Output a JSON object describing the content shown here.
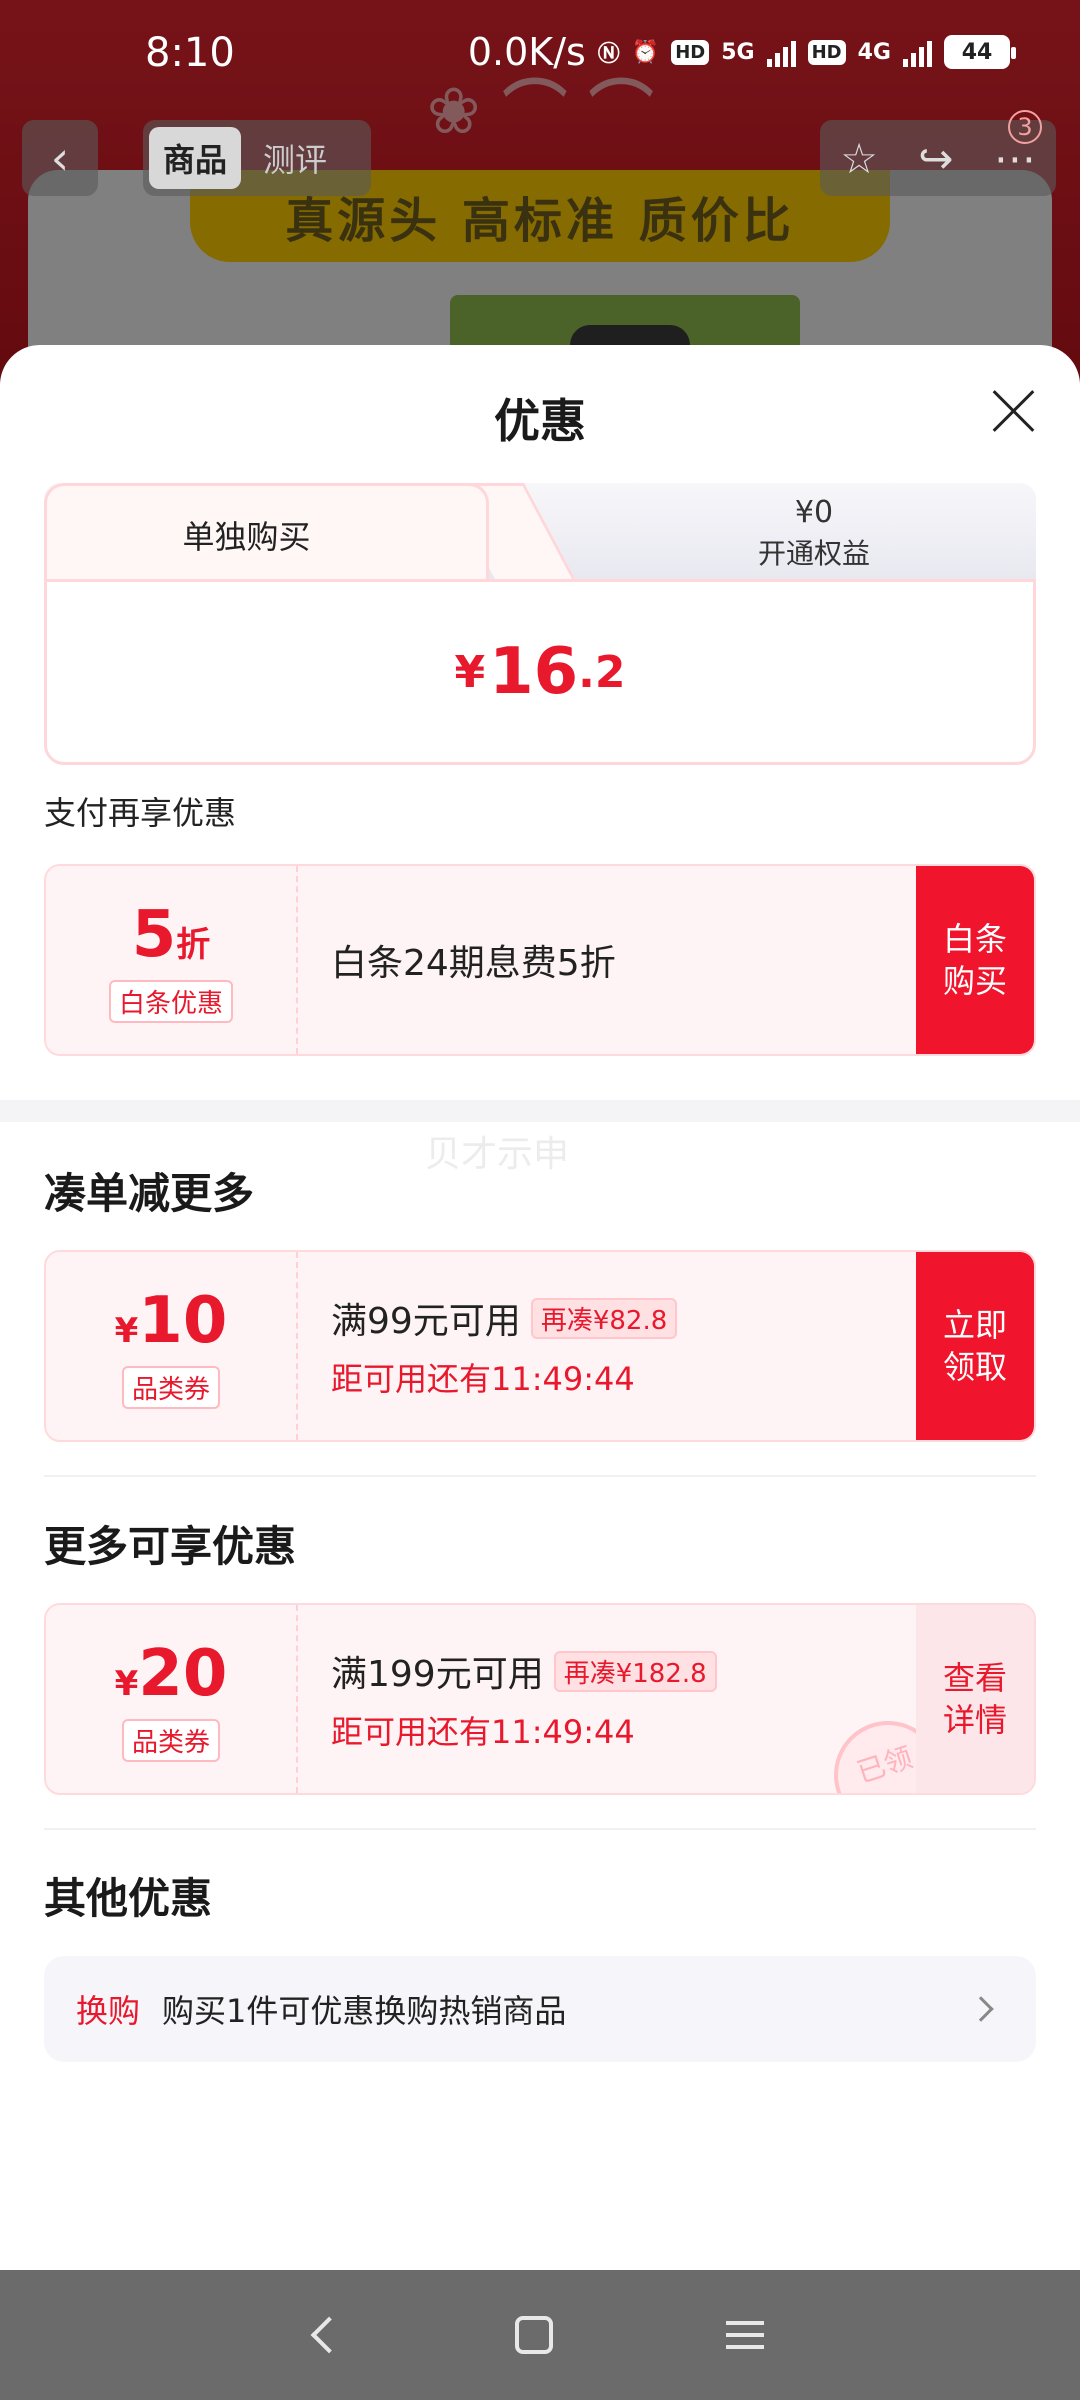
{
  "status_bar": {
    "time": "8:10",
    "net_speed": "0.0K/s",
    "battery": "44",
    "net1": "5G",
    "net2": "4G",
    "hd": "HD"
  },
  "product_nav": {
    "back_icon": "chevron-left-icon",
    "tabs": [
      "商品",
      "测评"
    ],
    "active_tab": "商品",
    "badge": "3",
    "banner": "真源头 高标准 质价比"
  },
  "sheet": {
    "title": "优惠",
    "close_icon": "close-icon"
  },
  "price_tabs": {
    "active_label": "单独购买",
    "other_amount": "¥0",
    "other_label": "开通权益",
    "price_yen": "¥",
    "price_int": "16",
    "price_dec": ".2"
  },
  "pay_section": {
    "label": "支付再享优惠",
    "coupon": {
      "value": "5",
      "unit": "折",
      "tag": "白条优惠",
      "text": "白条24期息费5折",
      "button": "白条购买"
    }
  },
  "watermark": "贝才示申",
  "combine_section": {
    "title": "凑单减更多",
    "coupon": {
      "yen": "¥",
      "value": "10",
      "tag": "品类券",
      "condition": "满99元可用",
      "chip": "再凑¥82.8",
      "countdown": "距可用还有11:49:44",
      "button": "立即领取"
    }
  },
  "more_section": {
    "title": "更多可享优惠",
    "coupon": {
      "yen": "¥",
      "value": "20",
      "tag": "品类券",
      "condition": "满199元可用",
      "chip": "再凑¥182.8",
      "countdown": "距可用还有11:49:44",
      "button": "查看详情",
      "stamp": "已领"
    }
  },
  "other_section": {
    "title": "其他优惠",
    "tag": "换购",
    "text": "购买1件可优惠换购热销商品"
  },
  "colors": {
    "accent": "#e8182d",
    "button_red": "#f0152c",
    "coupon_bg": "#fff4f5"
  }
}
